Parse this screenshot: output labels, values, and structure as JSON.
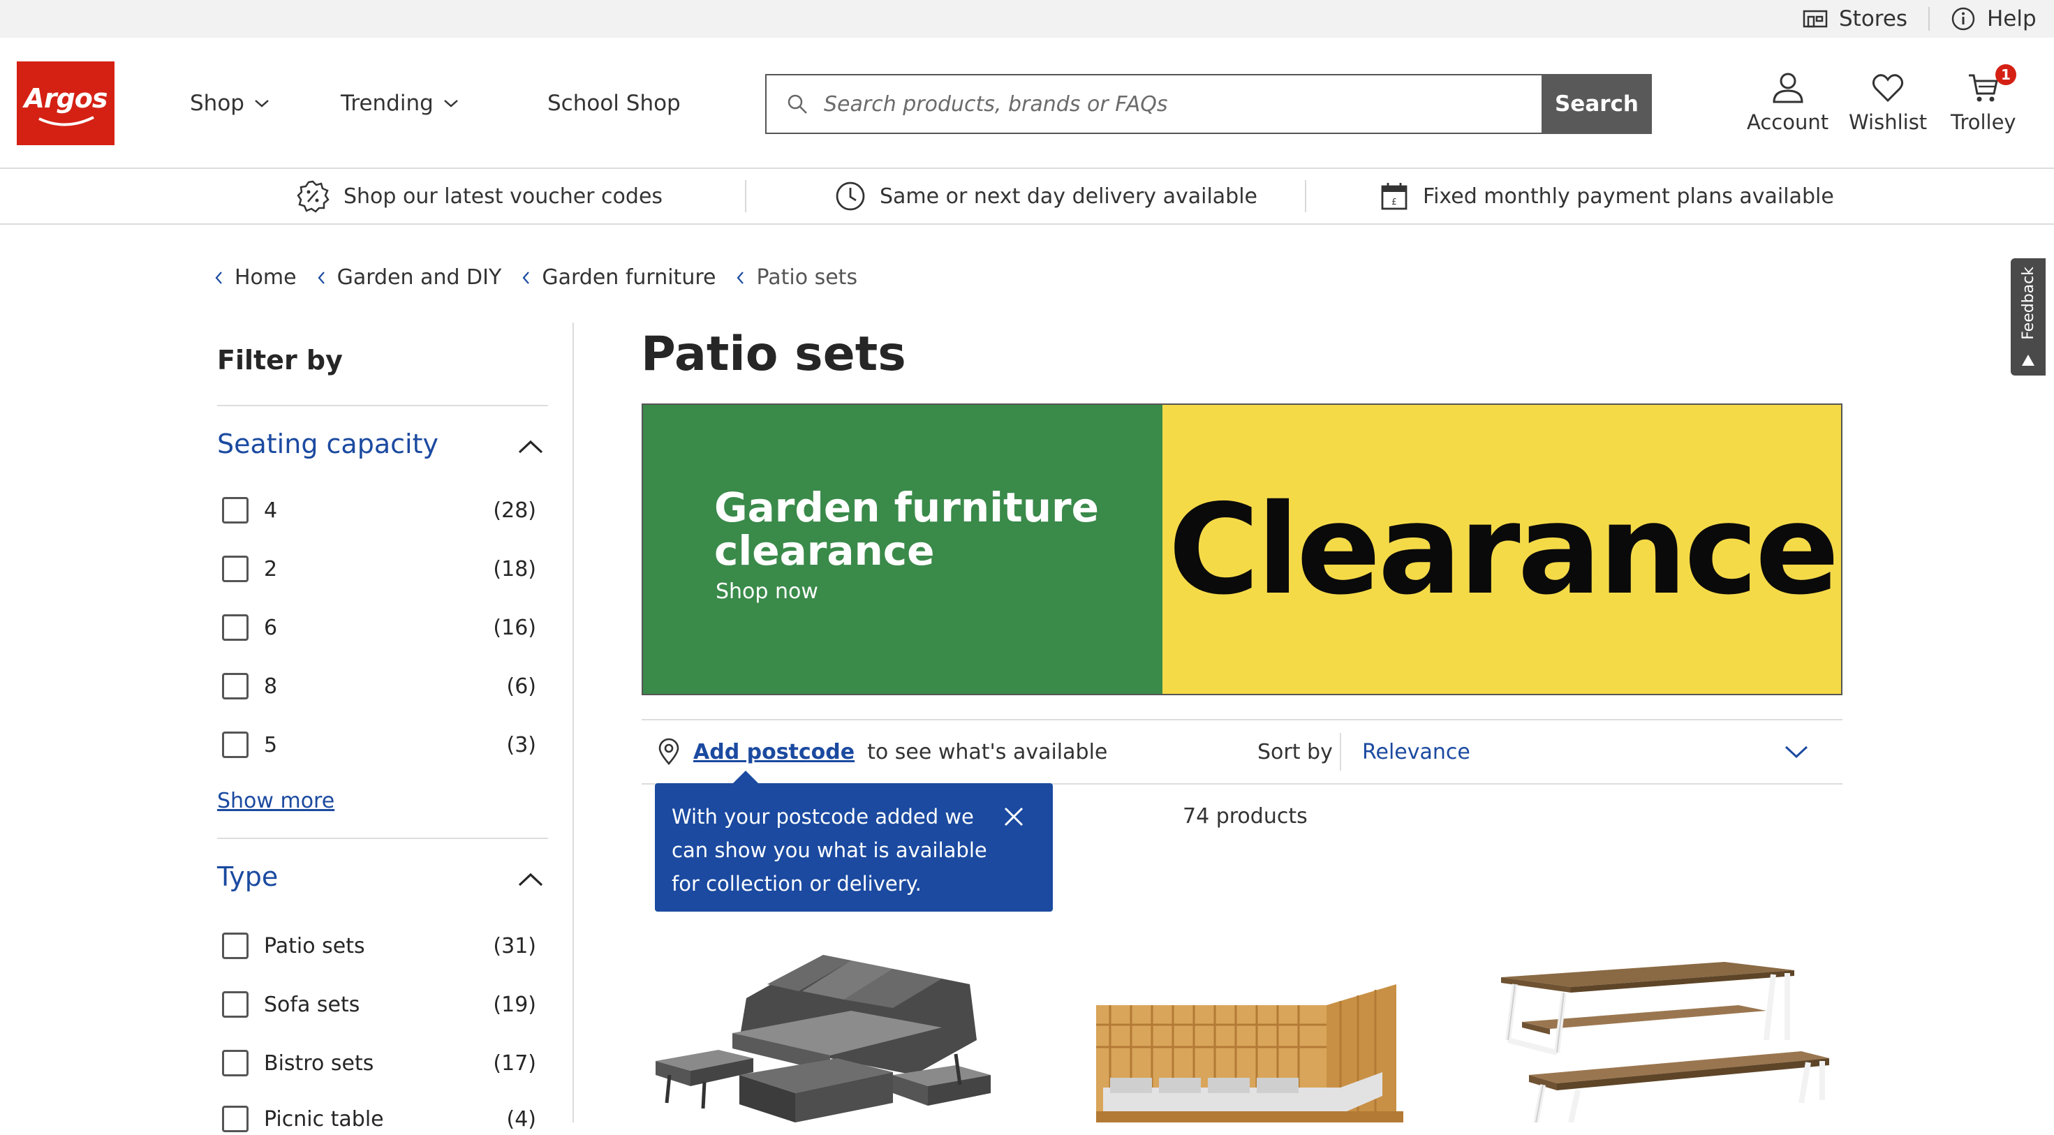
{
  "utility": {
    "stores": "Stores",
    "help": "Help"
  },
  "header": {
    "logo": "Argos",
    "nav": [
      {
        "label": "Shop"
      },
      {
        "label": "Trending"
      },
      {
        "label": "School Shop"
      }
    ],
    "search": {
      "placeholder": "Search products, brands or FAQs",
      "button": "Search"
    },
    "account": "Account",
    "wishlist": "Wishlist",
    "trolley": "Trolley",
    "trolley_count": "1"
  },
  "benefits": [
    "Shop our latest voucher codes",
    "Same or next day delivery available",
    "Fixed monthly payment plans available"
  ],
  "breadcrumb": [
    "Home",
    "Garden and DIY",
    "Garden furniture",
    "Patio sets"
  ],
  "feedback": "Feedback",
  "filters": {
    "title": "Filter by",
    "seating": {
      "title": "Seating capacity",
      "options": [
        {
          "label": "4",
          "count": "(28)"
        },
        {
          "label": "2",
          "count": "(18)"
        },
        {
          "label": "6",
          "count": "(16)"
        },
        {
          "label": "8",
          "count": "(6)"
        },
        {
          "label": "5",
          "count": "(3)"
        }
      ],
      "show_more": "Show more"
    },
    "type": {
      "title": "Type",
      "options": [
        {
          "label": "Patio sets",
          "count": "(31)"
        },
        {
          "label": "Sofa sets",
          "count": "(19)"
        },
        {
          "label": "Bistro sets",
          "count": "(17)"
        },
        {
          "label": "Picnic table",
          "count": "(4)"
        }
      ]
    }
  },
  "main": {
    "title": "Patio sets",
    "banner": {
      "headline": "Garden furniture clearance",
      "cta": "Shop now",
      "big_text": "Clearance"
    },
    "postcode": {
      "link": "Add postcode",
      "text": "to see what's available"
    },
    "sort": {
      "label": "Sort by",
      "value": "Relevance"
    },
    "tooltip": "With your postcode added we can show you what is available for collection or delivery.",
    "product_count": "74 products"
  },
  "colors": {
    "brand_red": "#d42114",
    "link_blue": "#1b4aa0",
    "banner_green": "#3a8a4a",
    "banner_yellow": "#f5da48"
  }
}
